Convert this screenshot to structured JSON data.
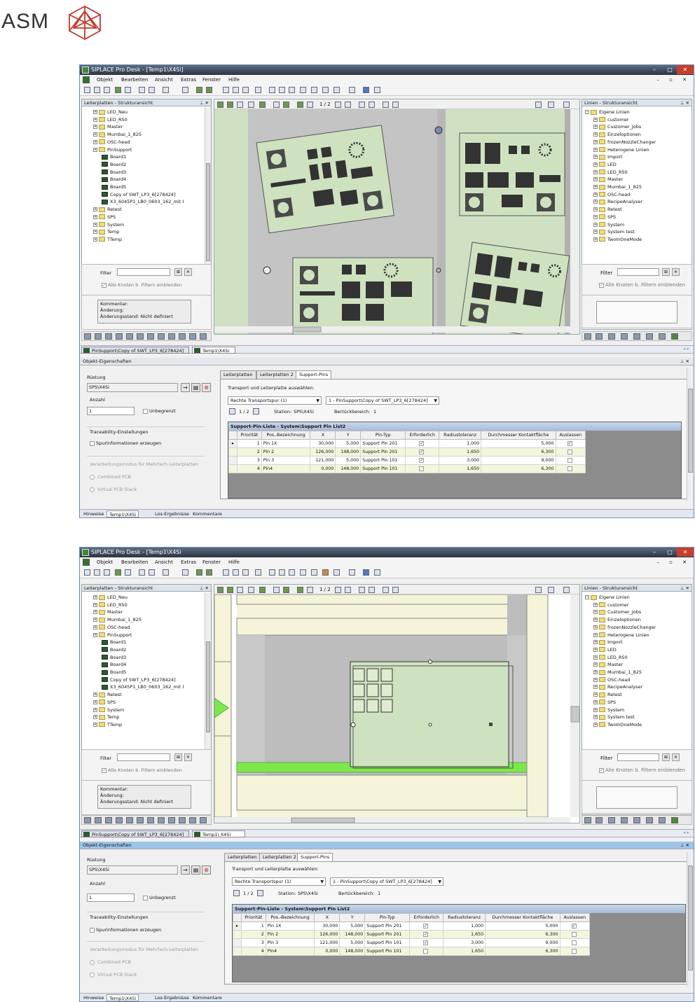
{
  "brand": {
    "logo_text": "ASM"
  },
  "shared": {
    "window_title_1": "SIPLACE Pro Desk - [Temp1\\X4Si]",
    "window_title_2": "SIPLACE Pro Desk - [Temp1\\X4Si",
    "menu": [
      "Objekt",
      "Bearbeiten",
      "Ansicht",
      "Extras",
      "Fenster",
      "Hilfe"
    ],
    "left_panel_title": "Leiterplatten - Strukturansicht",
    "right_panel_title": "Linien - Strukturansicht",
    "page_indicator": "1 / 2",
    "filter_label": "Filter",
    "filter_checkbox_label": "Alle Knoten b. Filtern einblenden",
    "comment_lines": [
      "Kommentar:",
      "Änderung:",
      "Änderungsstand: Nicht definiert"
    ],
    "doc_tab_1": "PinSupport\\Copy of SWT_LP3_6[278424]",
    "doc_tab_2_w1": "Temp1\\X4Si",
    "doc_tab_2_w2": "Temp1\\  X4Si",
    "props_title": "Objekt-Eigenschaften",
    "ruestung_label": "Rüstung",
    "ruestung_value": "SPS\\X4Si",
    "anzahl_label": "Anzahl",
    "anzahl_value": "1",
    "unbegrenzt_label": "Unbegrenzt",
    "traceability_label": "Traceability-Einstellungen",
    "spur_label": "Spurinformationen erzeugen",
    "verarbeitung_label": "Verarbeitungsmodus für Mehrfach-Leiterplatten",
    "combined_label": "Combined PCB",
    "virtual_label": "Virtual PCB Stack",
    "tabs": [
      "Leiterplatten",
      "Leiterplatten 2",
      "Support-Pins"
    ],
    "transport_label": "Transport und Leiterplatte auswählen:",
    "transport_select": "Rechte Transportspur (1)",
    "board_select": "1 - PinSupport\\Copy of SWT_LP3_6[278424]",
    "station_label": "Station:",
    "station_value": "SPS\\X4Si",
    "bestueck_label": "Bertückbereich:",
    "bestueck_value": "1",
    "pin_list_title": "Support-Pin-Liste - System\\Support Pin List2",
    "pin_columns": [
      "Priorität",
      "Pos.-Bezeichnung",
      "X",
      "Y",
      "Pin-Typ",
      "Erforderlich",
      "Radiustoleranz",
      "Durchmesser Kontaktfläche",
      "Auslassen"
    ],
    "pin_rows": [
      [
        "1",
        "Pin 1X",
        "30,000",
        "5,000",
        "Support Pin 201",
        "checked",
        "1,000",
        "5,000",
        "checked"
      ],
      [
        "2",
        "Pin 2",
        "126,000",
        "148,000",
        "Support Pin 201",
        "checked",
        "1,650",
        "6,300",
        ""
      ],
      [
        "3",
        "Pin 3",
        "121,000",
        "5,000",
        "Support Pin 101",
        "checked",
        "3,000",
        "9,000",
        ""
      ],
      [
        "4",
        "Pin4",
        "0,000",
        "148,000",
        "Support Pin 101",
        "",
        "1,650",
        "6,300",
        ""
      ]
    ],
    "bottom_tabs": [
      "Hinweise",
      "Temp1\\X4Si",
      "Los-Ergebnisse",
      "Kommentare"
    ],
    "colors": {
      "board_green": "#cfe2c0",
      "bright_green": "#7ee84a",
      "cream": "#f5f3d8",
      "title_bar": "#2a3342"
    }
  },
  "w1": {
    "left_tree": [
      {
        "label": "LED_Neu",
        "type": "folder",
        "level": 1
      },
      {
        "label": "LED_R50",
        "type": "folder",
        "level": 1
      },
      {
        "label": "Master",
        "type": "folder",
        "level": 1
      },
      {
        "label": "Mumbai_1_825",
        "type": "folder",
        "level": 1
      },
      {
        "label": "OSC-head",
        "type": "folder",
        "level": 1
      },
      {
        "label": "PinSupport",
        "type": "folder",
        "level": 1
      },
      {
        "label": "Board1",
        "type": "board",
        "level": 2
      },
      {
        "label": "Board2",
        "type": "board",
        "level": 2
      },
      {
        "label": "Board3",
        "type": "board",
        "level": 2
      },
      {
        "label": "Board4",
        "type": "board",
        "level": 2
      },
      {
        "label": "Board5",
        "type": "board",
        "level": 2
      },
      {
        "label": "Copy of SWT_LP3_6[278424]",
        "type": "board",
        "level": 2
      },
      {
        "label": "X3_6045P1_LB0_0603_162_mit I",
        "type": "board",
        "level": 2
      },
      {
        "label": "Retest",
        "type": "folder",
        "level": 1
      },
      {
        "label": "SPS",
        "type": "folder",
        "level": 1
      },
      {
        "label": "System",
        "type": "folder",
        "level": 1
      },
      {
        "label": "Temp",
        "type": "folder",
        "level": 1
      },
      {
        "label": "TTemp",
        "type": "folder",
        "level": 1
      }
    ],
    "right_tree": [
      {
        "label": "Eigene Linien",
        "level": 0
      },
      {
        "label": "customer",
        "level": 1
      },
      {
        "label": "Customer_Jobs",
        "level": 1
      },
      {
        "label": "Einzeloptionen",
        "level": 1
      },
      {
        "label": "frozenNozzleChanger",
        "level": 1
      },
      {
        "label": "Heterogene Linien",
        "level": 1
      },
      {
        "label": "Import",
        "level": 1
      },
      {
        "label": "LED",
        "level": 1
      },
      {
        "label": "LED_R50",
        "level": 1
      },
      {
        "label": "Master",
        "level": 1
      },
      {
        "label": "Mumbai_1_825",
        "level": 1
      },
      {
        "label": "OSC-head",
        "level": 1
      },
      {
        "label": "RecipeAnalyser",
        "level": 1
      },
      {
        "label": "Retest",
        "level": 1
      },
      {
        "label": "SPS",
        "level": 1
      },
      {
        "label": "System",
        "level": 1
      },
      {
        "label": "System test",
        "level": 1
      },
      {
        "label": "TwoInOneMode",
        "level": 1
      }
    ]
  },
  "w2": {
    "right_tree": [
      {
        "label": "Eigene Linien",
        "level": 0
      },
      {
        "label": "customer",
        "level": 1
      },
      {
        "label": "Customer_Jobs",
        "level": 1
      },
      {
        "label": "Einzeloptionen",
        "level": 1
      },
      {
        "label": "frozenNozzleChanger",
        "level": 1
      },
      {
        "label": "Heterogene Linien",
        "level": 1
      },
      {
        "label": "Import",
        "level": 1
      },
      {
        "label": "LED",
        "level": 1
      },
      {
        "label": "LED_R50",
        "level": 1
      },
      {
        "label": "Master",
        "level": 1
      },
      {
        "label": "Mumbai_1_825",
        "level": 1
      },
      {
        "label": "OSC-head",
        "level": 1
      },
      {
        "label": "RecipeAnalyser",
        "level": 1
      },
      {
        "label": "Retest",
        "level": 1
      },
      {
        "label": "SPS",
        "level": 1
      },
      {
        "label": "System",
        "level": 1
      },
      {
        "label": "System test",
        "level": 1
      },
      {
        "label": "TwoInOneMode",
        "level": 1
      }
    ]
  }
}
